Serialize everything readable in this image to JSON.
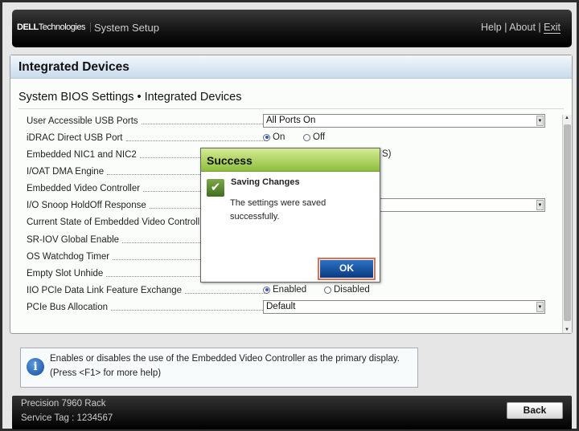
{
  "header": {
    "brand_dell": "DELL",
    "brand_tech": "Technologies",
    "app_title": "System Setup",
    "help": "Help",
    "about": "About",
    "exit": "Exit",
    "sep": "|"
  },
  "panel": {
    "title": "Integrated Devices",
    "subtitle": "System BIOS Settings • Integrated Devices"
  },
  "rows": [
    {
      "label": "User Accessible USB Ports",
      "value": "All Ports On"
    },
    {
      "label": "iDRAC Direct USB Port",
      "options": [
        "On",
        "Off"
      ],
      "selected": "On"
    },
    {
      "label": "Embedded NIC1 and NIC2",
      "value_partial": "S)"
    },
    {
      "label": "I/OAT DMA Engine"
    },
    {
      "label": "Embedded Video Controller"
    },
    {
      "label": "I/O Snoop HoldOff Response"
    },
    {
      "label": "Current State of Embedded Video Controll"
    },
    {
      "label": "SR-IOV Global Enable"
    },
    {
      "label": "OS Watchdog Timer"
    },
    {
      "label": "Empty Slot Unhide"
    },
    {
      "label": "IIO PCIe Data Link Feature Exchange",
      "options": [
        "Enabled",
        "Disabled"
      ],
      "selected": "Enabled"
    },
    {
      "label": "PCIe Bus Allocation",
      "value": "Default"
    }
  ],
  "help": {
    "line1": "Enables or disables the use of the Embedded Video Controller as the primary display.",
    "line2": "(Press <F1> for more help)"
  },
  "footer": {
    "model": "Precision 7960 Rack",
    "service_tag": "Service Tag : 1234567",
    "back": "Back"
  },
  "dialog": {
    "title": "Success",
    "heading": "Saving Changes",
    "message": "The settings were saved successfully.",
    "ok": "OK"
  }
}
